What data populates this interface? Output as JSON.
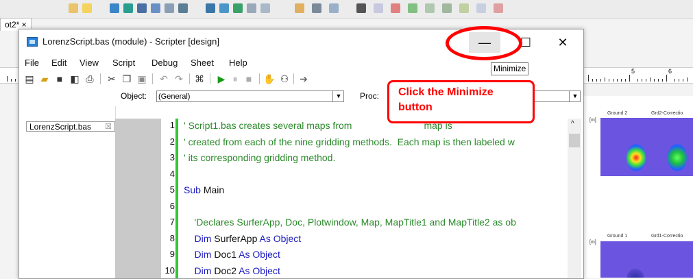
{
  "background": {
    "doc_tab": "ot2* ×",
    "ruler_numbers": [
      "5",
      "6"
    ],
    "thumbnails": [
      {
        "title_left": "Ground 2",
        "title_right": "Grd2-Correctio",
        "axis": "[m]"
      },
      {
        "title_left": "Ground 1",
        "title_right": "Grd1-Correctio",
        "axis": "[m]"
      }
    ]
  },
  "window": {
    "title": "LorenzScript.bas (module) - Scripter [design]",
    "minimize_glyph": "—",
    "maximize_glyph": "☐",
    "close_glyph": "✕"
  },
  "menu": [
    "File",
    "Edit",
    "View",
    "Script",
    "Debug",
    "Sheet",
    "Help"
  ],
  "toolbar_icons": [
    "new-file-icon",
    "open-folder-icon",
    "save-icon",
    "save-all-icon",
    "print-icon",
    "cut-icon",
    "copy-icon",
    "paste-icon",
    "undo-icon",
    "redo-icon",
    "dialog-editor-icon",
    "run-icon",
    "pause-icon",
    "stop-icon",
    "hand-icon",
    "watch-icon",
    "step-icon"
  ],
  "object_bar": {
    "object_label": "Object:",
    "object_value": "(General)",
    "proc_label": "Proc:"
  },
  "file_tab": {
    "label": "LorenzScript.bas",
    "close": "☒"
  },
  "code_lines": [
    {
      "num": "1",
      "segments": [
        {
          "t": "' Script1.bas creates several maps from ",
          "c": "cmt"
        },
        {
          "t": "                          map is",
          "c": "cmt"
        }
      ]
    },
    {
      "num": "2",
      "segments": [
        {
          "t": "' created from each of the nine gridding methods.  Each map is then labeled w",
          "c": "cmt"
        }
      ]
    },
    {
      "num": "3",
      "segments": [
        {
          "t": "' its corresponding gridding method.",
          "c": "cmt"
        }
      ]
    },
    {
      "num": "4",
      "segments": []
    },
    {
      "num": "5",
      "segments": [
        {
          "t": "Sub ",
          "c": "kw"
        },
        {
          "t": "Main",
          "c": "txt"
        }
      ]
    },
    {
      "num": "6",
      "segments": []
    },
    {
      "num": "7",
      "segments": [
        {
          "t": "    'Declares SurferApp, Doc, Plotwindow, Map, MapTitle1 and MapTitle2 as ob",
          "c": "cmt"
        }
      ]
    },
    {
      "num": "8",
      "segments": [
        {
          "t": "    Dim ",
          "c": "kw"
        },
        {
          "t": "SurferApp ",
          "c": "txt"
        },
        {
          "t": "As Object",
          "c": "kw"
        }
      ]
    },
    {
      "num": "9",
      "segments": [
        {
          "t": "    Dim ",
          "c": "kw"
        },
        {
          "t": "Doc1 ",
          "c": "txt"
        },
        {
          "t": "As Object",
          "c": "kw"
        }
      ]
    },
    {
      "num": "10",
      "segments": [
        {
          "t": "    Dim ",
          "c": "kw"
        },
        {
          "t": "Doc2 ",
          "c": "txt"
        },
        {
          "t": "As Object",
          "c": "kw"
        }
      ]
    }
  ],
  "tooltip": "Minimize",
  "callout": {
    "line1": "Click the Minimize",
    "line2": "button"
  },
  "colors": {
    "annotation": "#ff0000",
    "comment": "#2a8a2a",
    "keyword": "#1c1cbf"
  }
}
